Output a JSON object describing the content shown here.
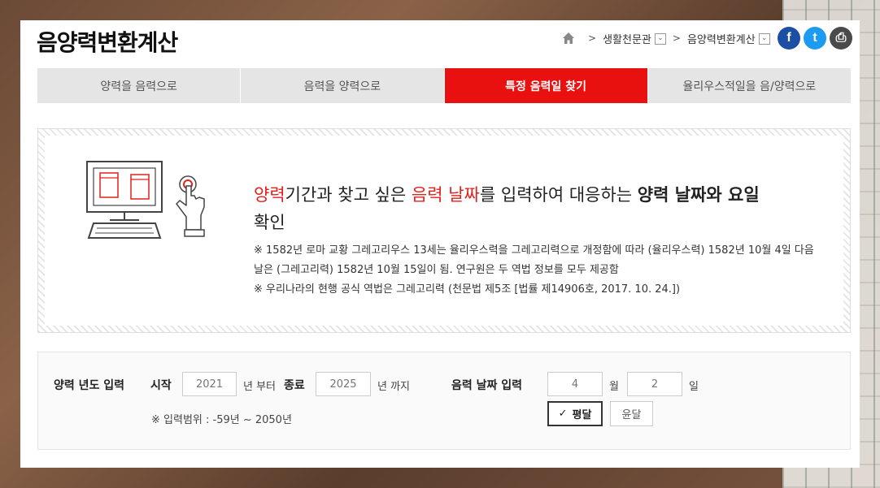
{
  "page": {
    "title": "음양력변환계산"
  },
  "breadcrumb": {
    "items": [
      {
        "label": "생활천문관"
      },
      {
        "label": "음양력변환계산"
      }
    ],
    "separator": ">",
    "dropdown_glyph": "⌄"
  },
  "share": {
    "facebook": "f",
    "twitter": "t",
    "print": "⎙"
  },
  "tabs": [
    {
      "label": "양력을 음력으로",
      "active": false
    },
    {
      "label": "음력을 양력으로",
      "active": false
    },
    {
      "label": "특정 음력일 찾기",
      "active": true
    },
    {
      "label": "율리우스적일을 음/양력으로",
      "active": false
    }
  ],
  "info": {
    "headline": {
      "part1_red": "양력",
      "part2": "기간과 찾고 싶은 ",
      "part3_red": "음력 날짜",
      "part4": "를 입력하여 대응하는 ",
      "part5_bold": "양력 날짜와 요일",
      "part6": "확인"
    },
    "notes": [
      "※ 1582년 로마 교황 그레고리우스 13세는 율리우스력을 그레고리력으로 개정함에 따라 (율리우스력) 1582년 10월 4일 다음 날은 (그레고리력) 1582년 10월 15일이 됨. 연구원은 두 역법 정보를 모두 제공함",
      "※ 우리나라의 현행 공식 역법은 그레고리력 (천문법 제5조 [법률 제14906호, 2017. 10. 24.])"
    ]
  },
  "form": {
    "year_label": "양력 년도 입력",
    "start_label": "시작",
    "start_placeholder": "2021",
    "start_suffix": "년 부터",
    "end_label": "종료",
    "end_placeholder": "2025",
    "end_suffix": "년 까지",
    "range_note": "※ 입력범위 : -59년 ~ 2050년",
    "lunar_label": "음력 날짜 입력",
    "month_placeholder": "4",
    "month_suffix": "월",
    "day_placeholder": "2",
    "day_suffix": "일",
    "normal_month_label": "평달",
    "leap_month_label": "윤달",
    "check_glyph": "✓"
  },
  "colors": {
    "accent": "#e8110f",
    "tab_bg": "#e5e5e5",
    "facebook": "#1c4fa3",
    "twitter": "#1d9bf0",
    "print": "#4a4a4a"
  }
}
